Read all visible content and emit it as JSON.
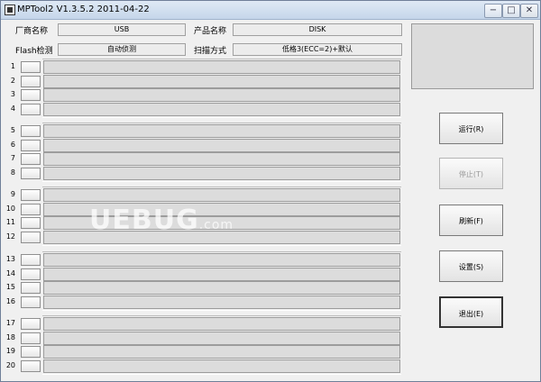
{
  "window": {
    "title": "MPTool2 V1.3.5.2 2011-04-22",
    "min": "−",
    "max": "□",
    "close": "✕"
  },
  "info": {
    "vendor_label": "厂商名称",
    "vendor_value": "USB",
    "product_label": "产品名称",
    "product_value": "DISK",
    "flash_label": "Flash检测",
    "flash_value": "自动侦测",
    "scan_label": "扫描方式",
    "scan_value": "低格3(ECC=2)+默认"
  },
  "ports": [
    "1",
    "2",
    "3",
    "4",
    "5",
    "6",
    "7",
    "8",
    "9",
    "10",
    "11",
    "12",
    "13",
    "14",
    "15",
    "16",
    "17",
    "18",
    "19",
    "20"
  ],
  "actions": {
    "run": "运行(R)",
    "stop": "停止(T)",
    "refresh": "刷新(F)",
    "settings": "设置(S)",
    "exit": "退出(E)"
  },
  "watermark": {
    "main": "UEBUG",
    "sub": ".com"
  }
}
